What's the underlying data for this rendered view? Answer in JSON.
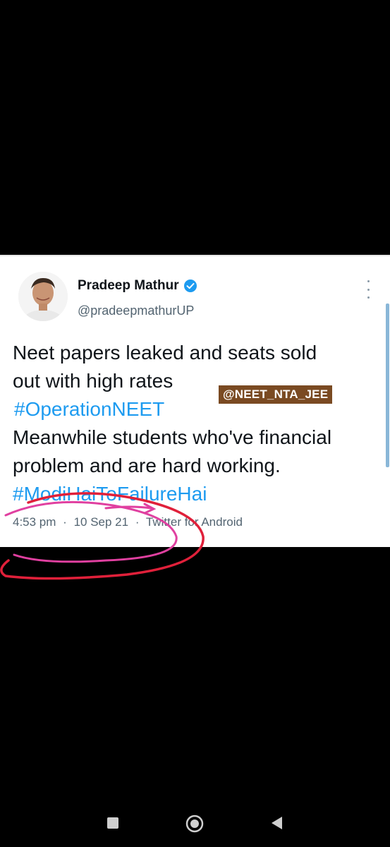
{
  "tweet": {
    "display_name": "Pradeep Mathur",
    "handle": "@pradeepmathurUP",
    "lines": [
      {
        "text": "Neet papers leaked and seats sold",
        "hashtag": false
      },
      {
        "text": "out with high rates",
        "hashtag": false
      },
      {
        "text": "#OperationNEET",
        "hashtag": true
      },
      {
        "text": "Meanwhile students who've financial",
        "hashtag": false
      },
      {
        "text": "problem and are hard working.",
        "hashtag": false
      },
      {
        "text": "#ModiHaiToFailureHai",
        "hashtag": true
      }
    ],
    "time": "4:53 pm",
    "date": "10 Sep 21",
    "source": "Twitter for Android",
    "separator": "·"
  },
  "watermark": "@NEET_NTA_JEE",
  "icons": {
    "verified": "verified-badge-icon",
    "more": "more-vertical-icon",
    "recent": "recent-apps-icon",
    "home": "home-icon",
    "back": "back-icon"
  },
  "colors": {
    "hashtag": "#1d9bf0",
    "verified": "#1d9bf0",
    "scribble_red": "#e0203a",
    "scribble_pink": "#e040a0",
    "watermark_bg": "#7a4a22"
  }
}
